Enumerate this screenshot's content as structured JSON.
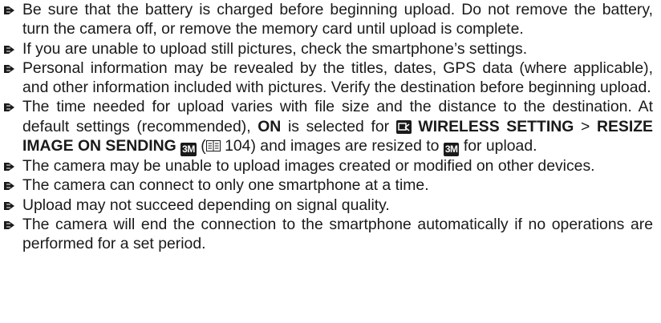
{
  "notes": [
    {
      "text": "Be sure that the battery is charged before beginning upload. Do not remove the battery, turn the camera off, or remove the memory card until upload is complete."
    },
    {
      "text": "If you are unable to upload still pictures, check the smartphone’s settings."
    },
    {
      "text": "Personal information may be revealed by the titles, dates, GPS data (where applicable), and other information included with pictures. Verify the destination before beginning upload."
    },
    {
      "parts": {
        "a": "The time needed for upload varies with file size and the distance to the destination. At default settings (recommended), ",
        "on": "ON",
        "b": " is selected for ",
        "wireless_setting": "WIRELESS SETTING",
        "gt": " > ",
        "resize": "RESIZE IMAGE ON SENDING",
        "size_badge": "3M",
        "c": " (",
        "page_ref": " 104",
        "d": ") and images are resized to ",
        "size_badge_2": "3M",
        "e": " for upload."
      },
      "icons": [
        "wireless-setting-icon",
        "book-page-ref-icon"
      ]
    },
    {
      "text": "The camera may be unable to upload images created or modified on other devices."
    },
    {
      "text": "The camera can connect to only one smartphone at a time."
    },
    {
      "text": "Upload may not succeed depending on signal quality."
    },
    {
      "text": "The camera will end the connection to the smartphone automatically if no operations are performed for a set period."
    }
  ],
  "colors": {
    "text": "#1a1a1a",
    "bullet": "#1a1a1a"
  }
}
